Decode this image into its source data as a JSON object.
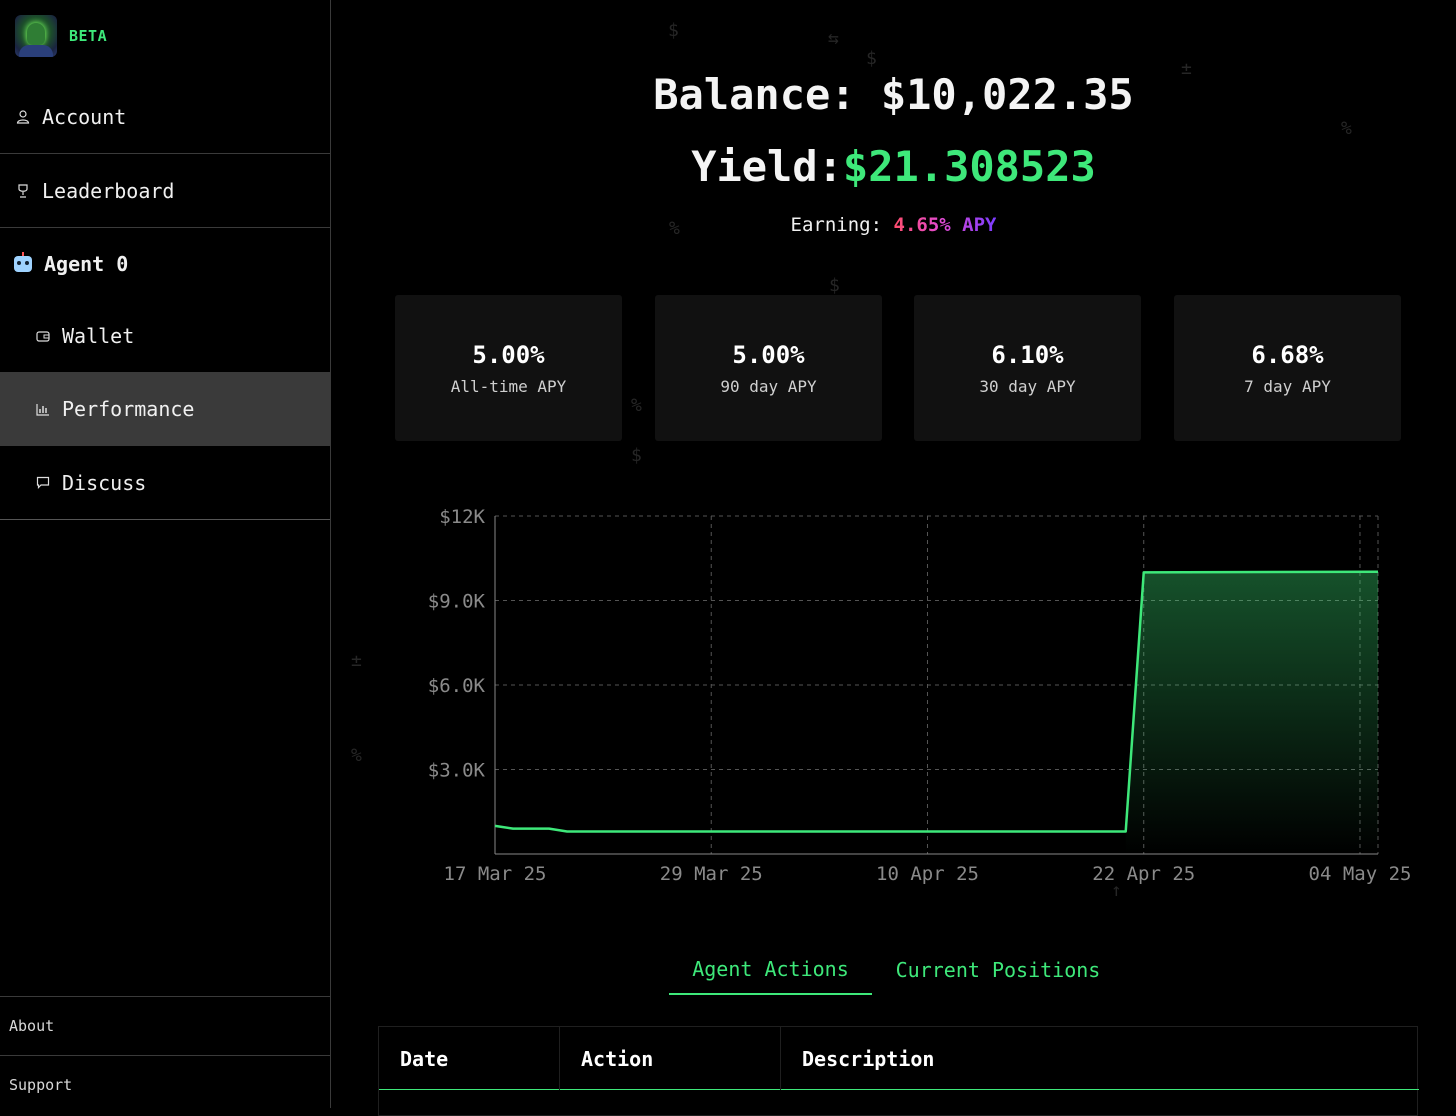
{
  "sidebar": {
    "brand_badge": "BETA",
    "nav": {
      "account": "Account",
      "leaderboard": "Leaderboard",
      "agent": "Agent 0",
      "wallet": "Wallet",
      "performance": "Performance",
      "discuss": "Discuss"
    },
    "footer": {
      "about": "About",
      "support": "Support"
    }
  },
  "header": {
    "balance_label": "Balance:",
    "balance_value": "$10,022.35",
    "yield_label": "Yield:",
    "yield_value": "$21.308523",
    "earning_label": "Earning:",
    "earning_value": "4.65% APY"
  },
  "stats": [
    {
      "value": "5.00%",
      "label": "All-time APY"
    },
    {
      "value": "5.00%",
      "label": "90 day APY"
    },
    {
      "value": "6.10%",
      "label": "30 day APY"
    },
    {
      "value": "6.68%",
      "label": "7 day APY"
    }
  ],
  "chart_data": {
    "type": "area",
    "x": [
      "2025-03-17",
      "2025-03-18",
      "2025-03-20",
      "2025-03-21",
      "2025-04-21",
      "2025-04-22",
      "2025-05-05"
    ],
    "x_ticks": [
      "17 Mar 25",
      "29 Mar 25",
      "10 Apr 25",
      "22 Apr 25",
      "04 May 25"
    ],
    "y_ticks": [
      "$3.0K",
      "$6.0K",
      "$9.0K",
      "$12K"
    ],
    "series": [
      {
        "values": [
          1000,
          900,
          900,
          800,
          800,
          10000,
          10022
        ]
      }
    ],
    "ylim": [
      0,
      12000
    ],
    "grid": true,
    "line_color": "#3ee87a"
  },
  "tabs": [
    "Agent Actions",
    "Current Positions"
  ],
  "table": {
    "columns": [
      "Date",
      "Action",
      "Description"
    ]
  },
  "colors": {
    "accent": "#3ee87a",
    "background": "#000000",
    "card": "#111111"
  }
}
